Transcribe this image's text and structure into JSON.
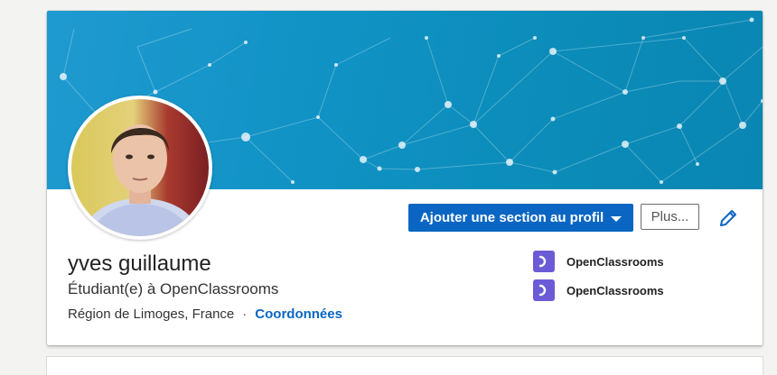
{
  "profile": {
    "name": "yves guillaume",
    "headline": "Étudiant(e) à OpenClassrooms",
    "location": "Région de Limoges, France",
    "separator": "·",
    "contact_label": "Coordonnées"
  },
  "actions": {
    "add_section_label": "Ajouter une section au profil",
    "more_label": "Plus..."
  },
  "organizations": [
    {
      "name": "OpenClassrooms",
      "icon": "openclassrooms-logo"
    },
    {
      "name": "OpenClassrooms",
      "icon": "openclassrooms-logo"
    }
  ],
  "colors": {
    "primary_button": "#0a66c2",
    "link": "#0a66c2",
    "banner": "#1193c6",
    "org_logo": "#6c5bd6"
  }
}
